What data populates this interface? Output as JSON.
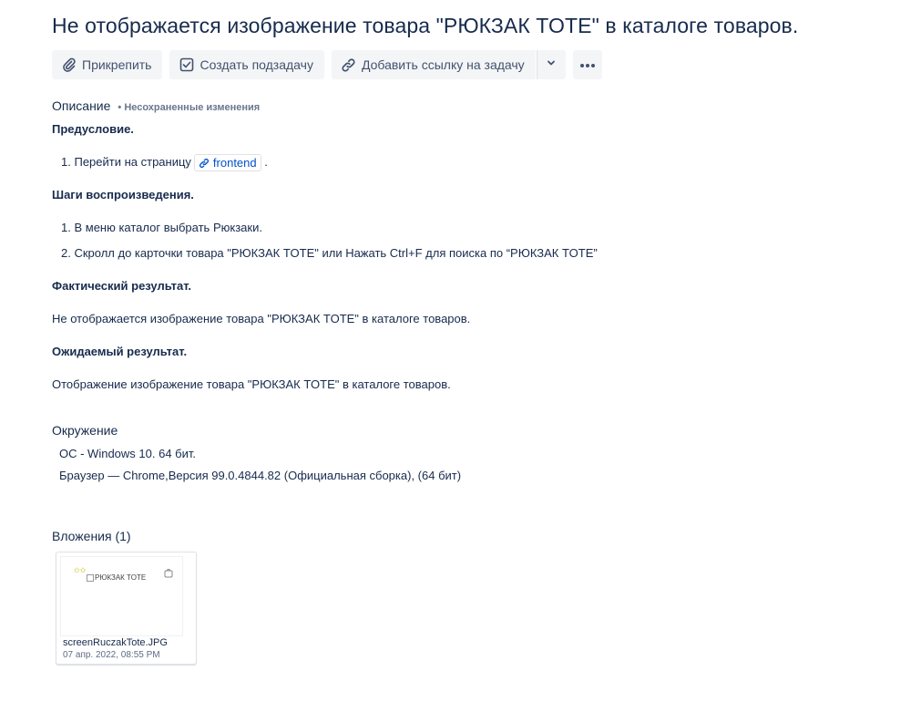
{
  "issue": {
    "title": "Не отображается изображение товара \"РЮКЗАК TOTE\" в каталоге товаров."
  },
  "toolbar": {
    "attach_label": "Прикрепить",
    "subtask_label": "Создать подзадачу",
    "link_label": "Добавить ссылку на задачу"
  },
  "description": {
    "label": "Описание",
    "unsaved": "• Несохраненные изменения",
    "precondition_heading": "Предусловие.",
    "precondition_steps": [
      {
        "num": "1.",
        "text": "Перейти на страницу",
        "link": "frontend",
        "suffix": "."
      }
    ],
    "steps_heading": "Шаги воспроизведения.",
    "steps": [
      {
        "num": "1.",
        "text": "В меню каталог выбрать Рюкзаки."
      },
      {
        "num": "2.",
        "text": "Скролл до карточки товара \"РЮКЗАК TOTE\" или Нажать Ctrl+F для поиска по “РЮКЗАК TOTE”"
      }
    ],
    "actual_heading": "Фактический результат.",
    "actual_text": "Не отображается изображение товара \"РЮКЗАК TOTE\" в каталоге товаров.",
    "expected_heading": "Ожидаемый результат.",
    "expected_text": "Отображение изображение товара \"РЮКЗАК TOTE\" в каталоге товаров."
  },
  "environment": {
    "label": "Окружение",
    "os": "ОС - Windows 10. 64 бит.",
    "browser": "Браузер — Chrome,Версия 99.0.4844.82 (Официальная сборка), (64 бит)"
  },
  "attachments": {
    "label": "Вложения (1)",
    "items": [
      {
        "thumb_alt": "РЮКЗАК TOTE",
        "filename": "screenRuczakTote.JPG",
        "date": "07 апр. 2022, 08:55 PM"
      }
    ]
  },
  "colors": {
    "text": "#172b4d",
    "link": "#0052cc",
    "button_bg": "#f4f5f7",
    "subtle": "#6b778c"
  }
}
